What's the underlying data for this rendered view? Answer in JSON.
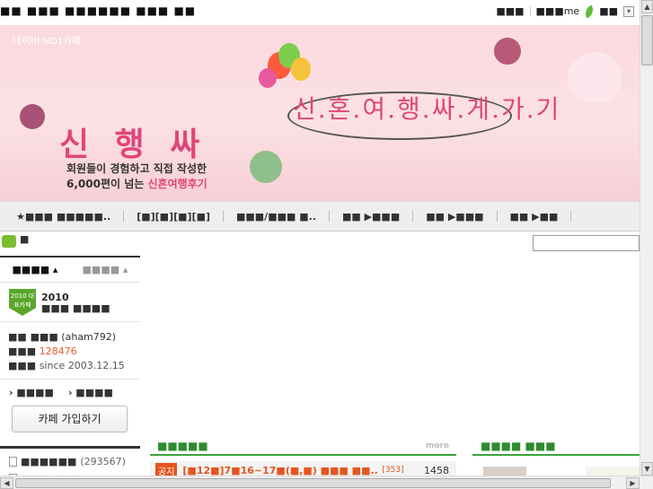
{
  "topbar": {
    "crumbs": "■■ ■■■ ■■■■■■ ■■■ ■■",
    "links": [
      "■■■",
      "■■■me",
      "■■"
    ],
    "dropdown_glyph": "▾"
  },
  "banner": {
    "brand": "네이버 NO1카페",
    "title": "신 행 싸",
    "slogan": "신.혼.여.행.싸.게.가.기",
    "sub_line1": "회원들이 경험하고 직접 작성한",
    "sub_line2_prefix": "6,000편이 넘는",
    "sub_line2_highlight": "신혼여행후기"
  },
  "menu": {
    "items": [
      "★■■■ ■■■■■..",
      "[■][■][■][■]",
      "■■■/■■■ ■..",
      "■■ ▶■■■",
      "■■ ▶■■■",
      "■■ ▶■■"
    ]
  },
  "cafe_mark": "■",
  "sidebar": {
    "tabs": [
      "■■■■ ▴",
      "■■■■ ▴"
    ],
    "badge_text": "2010 대표카페",
    "rank_year": "2010",
    "rank_label": "■■■ ■■■■",
    "manager_label": "■■ ■■■",
    "manager_id": "(aham792)",
    "member_label": "■■■",
    "member_count": "128476",
    "since_label": "■■■",
    "since": "since 2003.12.15",
    "links": [
      "› ■■■■",
      "› ■■■■"
    ],
    "join_button": "카페 가입하기",
    "boards": [
      {
        "name": "■■■■■■",
        "count": "(293567)"
      },
      {
        "name": "■■■ ■■■",
        "count": ""
      }
    ]
  },
  "notice": {
    "title": "■■■■■",
    "more": "more",
    "row": {
      "tag": "공지",
      "subject": "[■12■]7■16~17■(■,■) ■■■ ■■..",
      "comments": "[353]",
      "views": "1458"
    }
  },
  "photo": {
    "title": "■■■■ ■■■"
  },
  "scroll": {
    "up": "▲",
    "down": "▼",
    "left": "◀",
    "right": "▶"
  }
}
